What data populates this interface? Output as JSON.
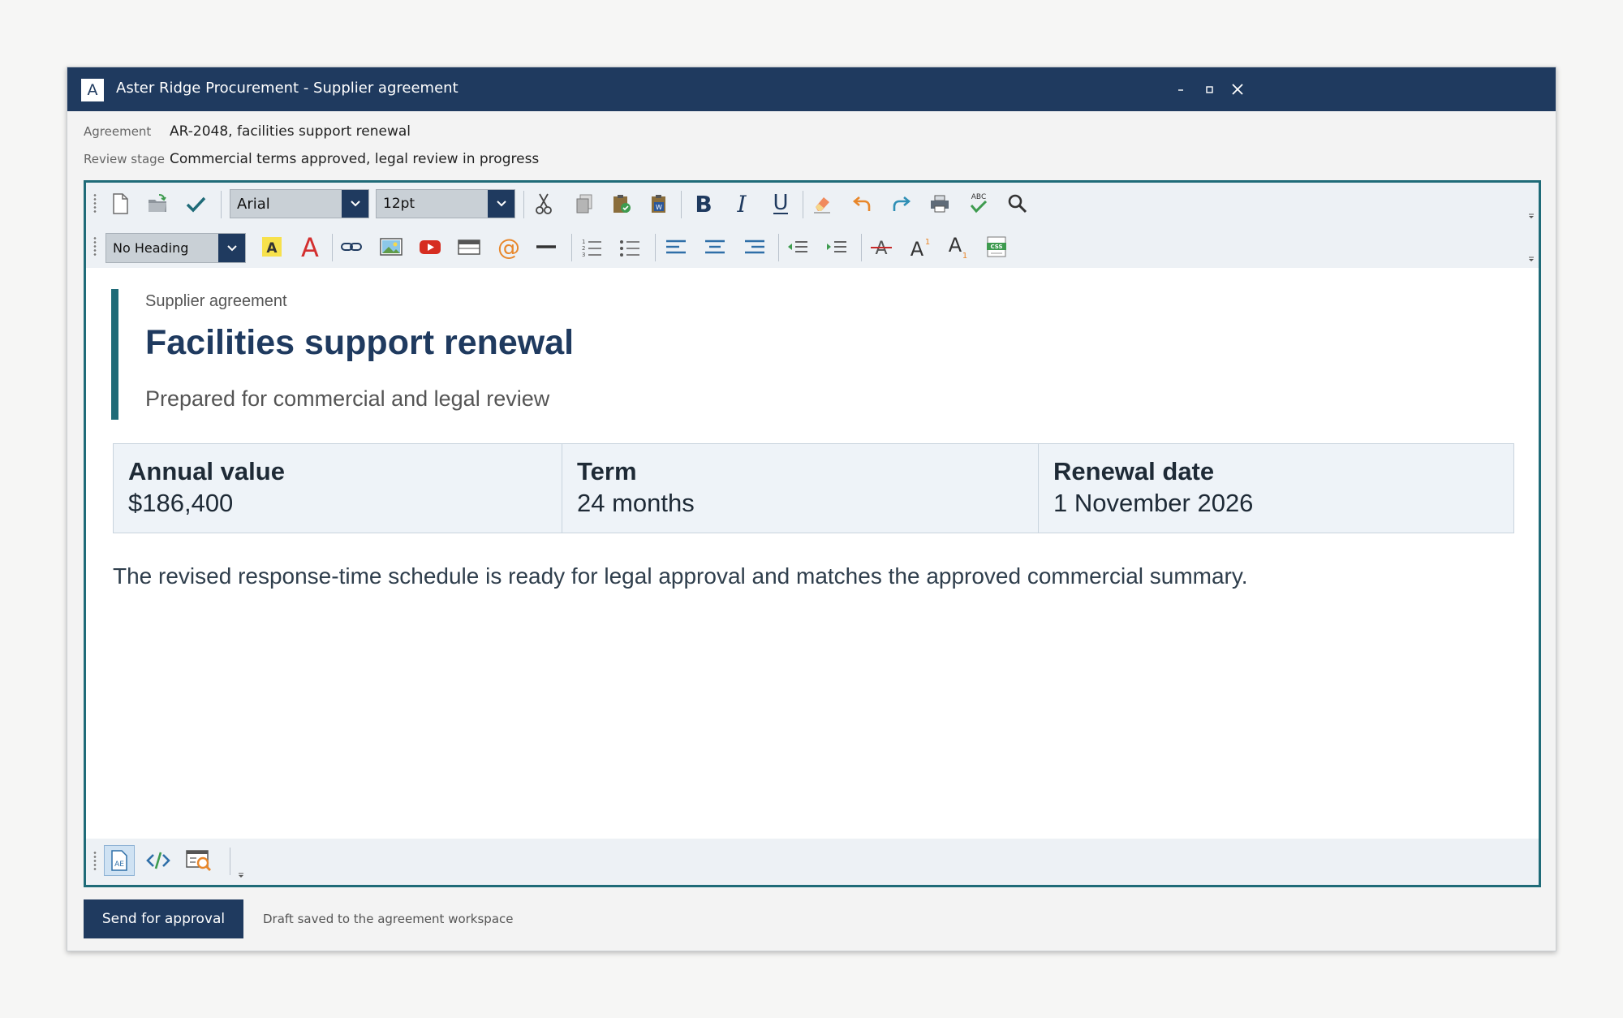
{
  "window": {
    "app_letter": "A",
    "title": "Aster Ridge Procurement - Supplier agreement"
  },
  "meta": {
    "agreement_label": "Agreement",
    "agreement_value": "AR-2048, facilities support renewal",
    "stage_label": "Review stage",
    "stage_value": "Commercial terms approved, legal review in progress"
  },
  "toolbar": {
    "font_value": "Arial",
    "size_value": "12pt",
    "heading_value": "No Heading"
  },
  "document": {
    "kicker": "Supplier agreement",
    "title": "Facilities support renewal",
    "subtitle": "Prepared for commercial and legal review",
    "facts": [
      {
        "label": "Annual value",
        "value": "$186,400"
      },
      {
        "label": "Term",
        "value": "24 months"
      },
      {
        "label": "Renewal date",
        "value": "1 November 2026"
      }
    ],
    "paragraph": "The revised response-time schedule is ready for legal approval and matches the approved commercial summary."
  },
  "footer": {
    "send_label": "Send for approval",
    "status": "Draft saved to the agreement workspace"
  },
  "icons": {
    "toolbar_row1": [
      "new-document-icon",
      "open-folder-icon",
      "checkmark-icon",
      "cut-icon",
      "copy-icon",
      "paste-icon",
      "paste-from-word-icon",
      "bold-icon",
      "italic-icon",
      "underline-icon",
      "eraser-icon",
      "undo-icon",
      "redo-icon",
      "print-icon",
      "spellcheck-icon",
      "search-icon"
    ],
    "toolbar_row2": [
      "highlight-color-icon",
      "font-color-icon",
      "link-icon",
      "image-icon",
      "video-icon",
      "table-icon",
      "email-at-icon",
      "horizontal-rule-icon",
      "ordered-list-icon",
      "unordered-list-icon",
      "align-left-icon",
      "align-center-icon",
      "align-right-icon",
      "outdent-icon",
      "indent-icon",
      "strikethrough-icon",
      "superscript-icon",
      "subscript-icon",
      "css-icon"
    ],
    "bottom": [
      "design-view-icon",
      "code-view-icon",
      "preview-icon"
    ]
  },
  "colors": {
    "titlebar": "#1f3a5f",
    "accent": "#1f6b78",
    "title_text": "#1f3a5f"
  }
}
